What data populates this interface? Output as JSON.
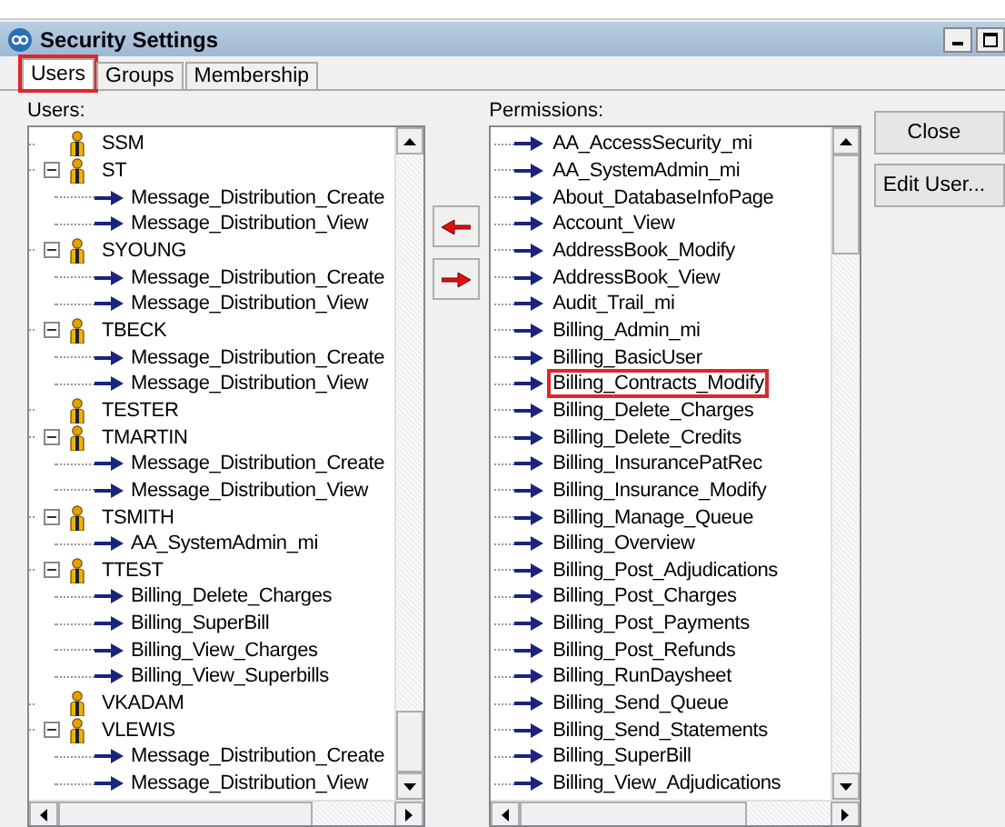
{
  "window": {
    "title": "Security Settings"
  },
  "tabs": [
    {
      "label": "Users",
      "selected": true,
      "highlighted": true
    },
    {
      "label": "Groups",
      "selected": false,
      "highlighted": false
    },
    {
      "label": "Membership",
      "selected": false,
      "highlighted": false
    }
  ],
  "users_label": "Users:",
  "users": [
    {
      "name": "SSM"
    },
    {
      "name": "ST",
      "expanded": true,
      "children": [
        {
          "name": "Message_Distribution_Create"
        },
        {
          "name": "Message_Distribution_View"
        }
      ]
    },
    {
      "name": "SYOUNG",
      "expanded": true,
      "children": [
        {
          "name": "Message_Distribution_Create"
        },
        {
          "name": "Message_Distribution_View"
        }
      ]
    },
    {
      "name": "TBECK",
      "expanded": true,
      "children": [
        {
          "name": "Message_Distribution_Create"
        },
        {
          "name": "Message_Distribution_View"
        }
      ]
    },
    {
      "name": "TESTER"
    },
    {
      "name": "TMARTIN",
      "expanded": true,
      "children": [
        {
          "name": "Message_Distribution_Create"
        },
        {
          "name": "Message_Distribution_View"
        }
      ]
    },
    {
      "name": "TSMITH",
      "expanded": true,
      "children": [
        {
          "name": "AA_SystemAdmin_mi"
        }
      ]
    },
    {
      "name": "TTEST",
      "expanded": true,
      "children": [
        {
          "name": "Billing_Delete_Charges"
        },
        {
          "name": "Billing_SuperBill"
        },
        {
          "name": "Billing_View_Charges"
        },
        {
          "name": "Billing_View_Superbills"
        }
      ]
    },
    {
      "name": "VKADAM"
    },
    {
      "name": "VLEWIS",
      "expanded": true,
      "children": [
        {
          "name": "Message_Distribution_Create"
        },
        {
          "name": "Message_Distribution_View"
        }
      ]
    }
  ],
  "permissions_label": "Permissions:",
  "permissions": [
    {
      "name": "AA_AccessSecurity_mi",
      "highlighted": false
    },
    {
      "name": "AA_SystemAdmin_mi",
      "highlighted": false
    },
    {
      "name": "About_DatabaseInfoPage",
      "highlighted": false
    },
    {
      "name": "Account_View",
      "highlighted": false
    },
    {
      "name": "AddressBook_Modify",
      "highlighted": false
    },
    {
      "name": "AddressBook_View",
      "highlighted": false
    },
    {
      "name": "Audit_Trail_mi",
      "highlighted": false
    },
    {
      "name": "Billing_Admin_mi",
      "highlighted": false
    },
    {
      "name": "Billing_BasicUser",
      "highlighted": false
    },
    {
      "name": "Billing_Contracts_Modify",
      "highlighted": true
    },
    {
      "name": "Billing_Delete_Charges",
      "highlighted": false
    },
    {
      "name": "Billing_Delete_Credits",
      "highlighted": false
    },
    {
      "name": "Billing_InsurancePatRec",
      "highlighted": false
    },
    {
      "name": "Billing_Insurance_Modify",
      "highlighted": false
    },
    {
      "name": "Billing_Manage_Queue",
      "highlighted": false
    },
    {
      "name": "Billing_Overview",
      "highlighted": false
    },
    {
      "name": "Billing_Post_Adjudications",
      "highlighted": false
    },
    {
      "name": "Billing_Post_Charges",
      "highlighted": false
    },
    {
      "name": "Billing_Post_Payments",
      "highlighted": false
    },
    {
      "name": "Billing_Post_Refunds",
      "highlighted": false
    },
    {
      "name": "Billing_RunDaysheet",
      "highlighted": false
    },
    {
      "name": "Billing_Send_Queue",
      "highlighted": false
    },
    {
      "name": "Billing_Send_Statements",
      "highlighted": false
    },
    {
      "name": "Billing_SuperBill",
      "highlighted": false
    },
    {
      "name": "Billing_View_Adjudications",
      "highlighted": false
    }
  ],
  "buttons": [
    {
      "label": "Close"
    },
    {
      "label": "Edit User..."
    }
  ]
}
